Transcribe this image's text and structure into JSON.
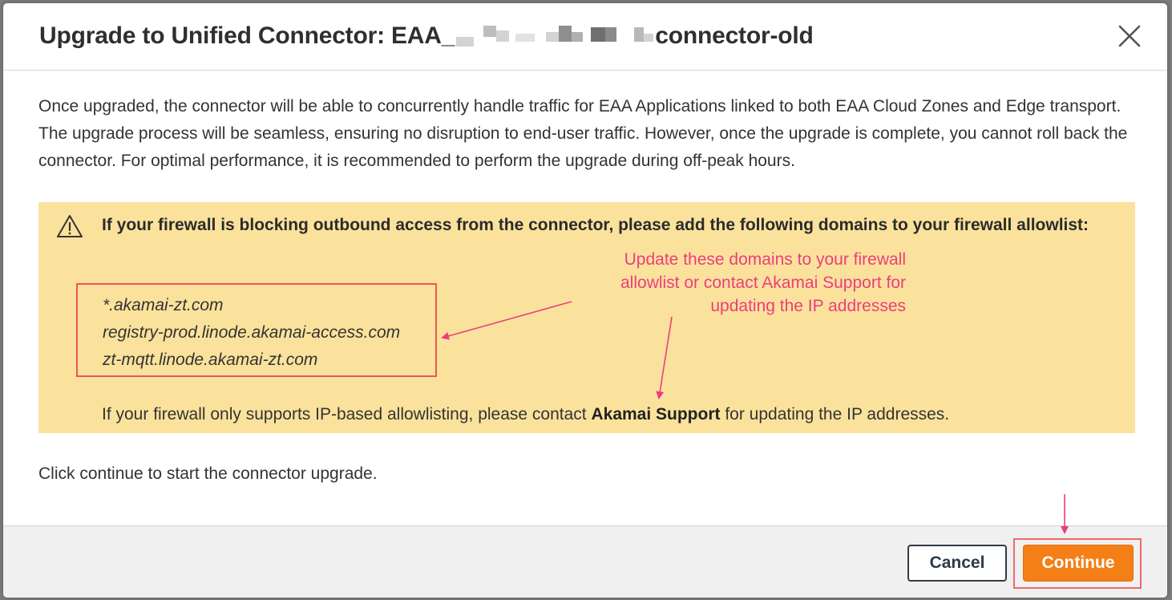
{
  "dialog": {
    "title_prefix": "Upgrade to Unified Connector: EAA_",
    "title_suffix": "connector-old",
    "close_label": "×"
  },
  "body": {
    "description": "Once upgraded, the connector will be able to concurrently handle traffic for EAA Applications linked to both EAA Cloud Zones and Edge transport. The upgrade process will be seamless, ensuring no disruption to end-user traffic. However, once the upgrade is complete, you cannot roll back the connector. For optimal performance, it is recommended to perform the upgrade during off-peak hours.",
    "click_continue": "Click continue to start the connector upgrade."
  },
  "warning": {
    "icon": "warning-triangle-icon",
    "title": "If your firewall is blocking outbound access from the connector, please add the following domains to your firewall allowlist:",
    "domains": [
      "*.akamai-zt.com",
      "registry-prod.linode.akamai-access.com",
      "zt-mqtt.linode.akamai-zt.com"
    ],
    "note_before": "If your firewall only supports IP-based allowlisting, please contact ",
    "note_bold": "Akamai Support",
    "note_after": " for updating the IP addresses.",
    "background": "#fbe29c"
  },
  "annotation": {
    "line1": "Update  these domains  to your firewall",
    "line2": "allowlist or contact Akamai Support  for",
    "line3": "updating the IP addresses",
    "color": "#ec3d7d"
  },
  "footer": {
    "cancel_label": "Cancel",
    "continue_label": "Continue",
    "accent": "#f57f17"
  }
}
